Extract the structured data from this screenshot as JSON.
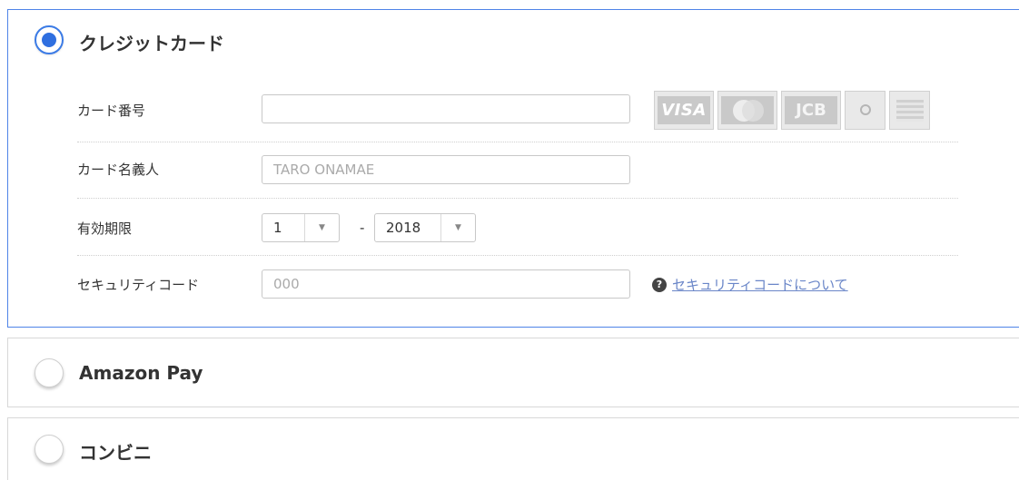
{
  "credit_card": {
    "title": "クレジットカード",
    "selected": true,
    "card_number": {
      "label": "カード番号",
      "value": "",
      "placeholder": ""
    },
    "brands": [
      "VISA",
      "mastercard",
      "JCB",
      "Diners Club",
      "American Express"
    ],
    "card_holder": {
      "label": "カード名義人",
      "value": "",
      "placeholder": "TARO ONAMAE"
    },
    "expiry": {
      "label": "有効期限",
      "month": "1",
      "separator": "-",
      "year": "2018",
      "arrow": "▼"
    },
    "security_code": {
      "label": "セキュリティコード",
      "value": "",
      "placeholder": "000",
      "help_icon": "?",
      "help_link": "セキュリティコードについて"
    }
  },
  "amazon_pay": {
    "title": "Amazon Pay",
    "selected": false
  },
  "konbini": {
    "title": "コンビニ",
    "selected": false
  },
  "colors": {
    "accent": "#2f6fe0",
    "link": "#6a86c8",
    "border_active": "#4f84e8",
    "border": "#d8d8d8"
  }
}
